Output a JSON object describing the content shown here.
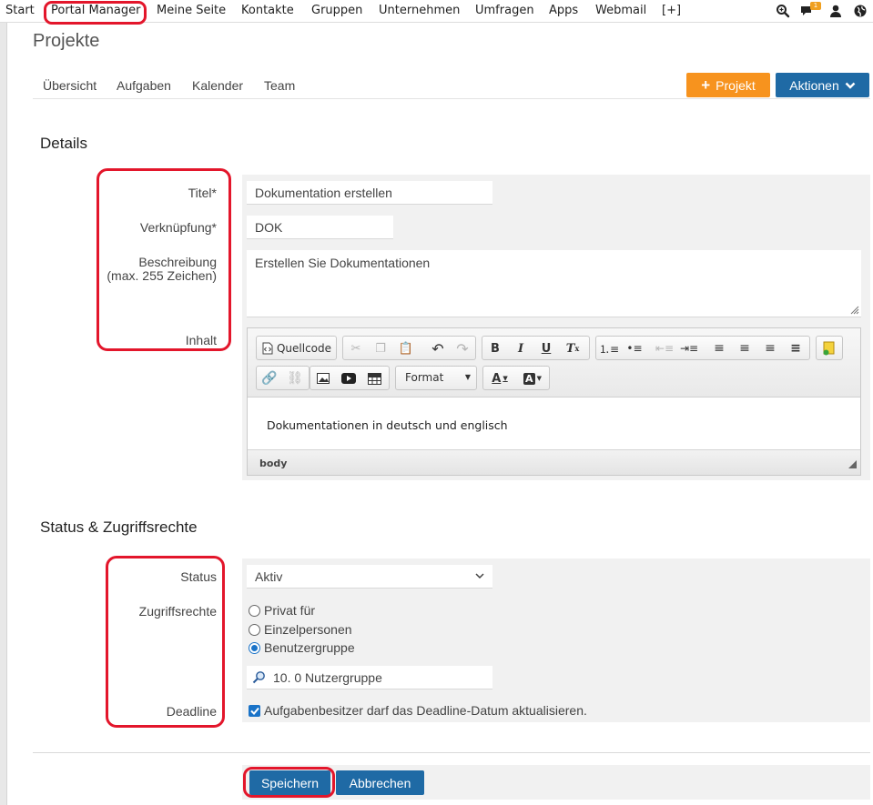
{
  "nav": {
    "items": [
      "Start",
      "Portal Manager",
      "Meine Seite",
      "Kontakte",
      "Gruppen",
      "Unternehmen",
      "Umfragen",
      "Apps",
      "Webmail",
      "[+]"
    ],
    "notification_count": "1",
    "icons": [
      "search-zoom-icon",
      "chat-icon",
      "user-icon",
      "globe-icon"
    ]
  },
  "page": {
    "title": "Projekte"
  },
  "subnav": {
    "items": [
      "Übersicht",
      "Aufgaben",
      "Kalender",
      "Team"
    ]
  },
  "actions": {
    "add_project": "Projekt",
    "actions_menu": "Aktionen"
  },
  "details": {
    "title": "Details",
    "labels": {
      "title": "Titel*",
      "link": "Verknüpfung*",
      "description": "Beschreibung",
      "description_hint": "(max. 255 Zeichen)",
      "content": "Inhalt"
    },
    "values": {
      "title": "Dokumentation erstellen",
      "link": "DOK",
      "description": "Erstellen Sie Dokumentationen"
    }
  },
  "editor": {
    "source_label": "Quellcode",
    "format_label": "Format",
    "content": "Dokumentationen in deutsch und englisch",
    "path": "body"
  },
  "status": {
    "title": "Status & Zugriffsrechte",
    "labels": {
      "status": "Status",
      "access": "Zugriffsrechte",
      "deadline": "Deadline"
    },
    "status_value": "Aktiv",
    "access_options": [
      "Privat für",
      "Einzelpersonen",
      "Benutzergruppe"
    ],
    "access_selected": 2,
    "group_value": "10. 0 Nutzergruppe",
    "deadline_text": "Aufgabenbesitzer darf das Deadline-Datum aktualisieren."
  },
  "footer": {
    "save": "Speichern",
    "cancel": "Abbrechen"
  },
  "colors": {
    "accent": "#1f6aa5",
    "orange": "#f7931e",
    "highlight": "#e3162b"
  }
}
